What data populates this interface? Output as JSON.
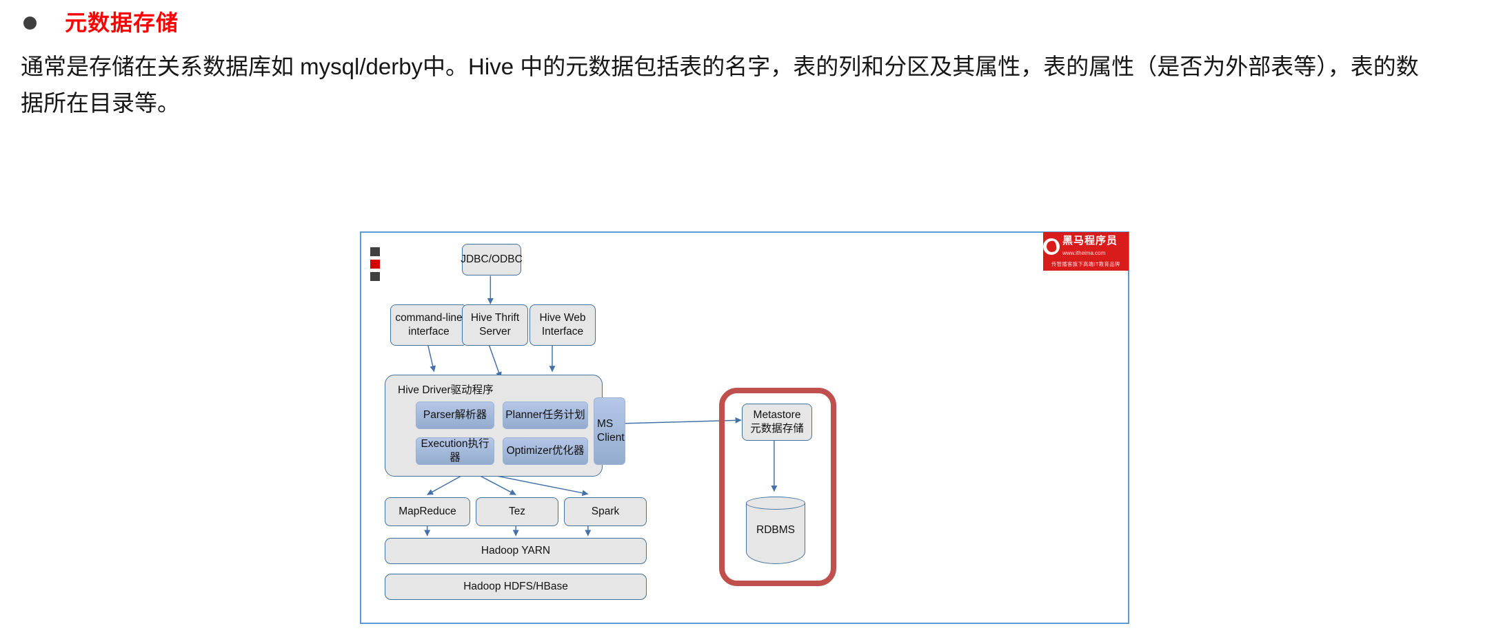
{
  "slide": {
    "heading": "元数据存储",
    "heading_color": "#ff0000",
    "paragraph": "通常是存储在关系数据库如 mysql/derby中。Hive 中的元数据包括表的名字，表的列和分区及其属性，表的属性（是否为外部表等），表的数据所在目录等。"
  },
  "diagram": {
    "border_color": "#5b9bd5",
    "node_fill": "#e6e6e6",
    "node_border": "#41719c",
    "subnode_fill": "#93accd",
    "highlight_color": "#c0504d",
    "nodes": {
      "jdbc_odbc": "JDBC/ODBC",
      "cli": "command-line\ninterface",
      "cli_line1": "command-line",
      "cli_line2": "interface",
      "thrift_line1": "Hive Thrift",
      "thrift_line2": "Server",
      "web_line1": "Hive Web",
      "web_line2": "Interface",
      "driver_label": "Hive Driver驱动程序",
      "parser": "Parser解析器",
      "planner": "Planner任务计划",
      "execution": "Execution执行器",
      "optimizer": "Optimizer优化器",
      "ms_client_line1": "MS",
      "ms_client_line2": "Client",
      "metastore_line1": "Metastore",
      "metastore_line2": "元数据存储",
      "rdbms": "RDBMS",
      "mapreduce": "MapReduce",
      "tez": "Tez",
      "spark": "Spark",
      "yarn": "Hadoop YARN",
      "hdfs": "Hadoop HDFS/HBase"
    },
    "logo": {
      "name_cn": "黑马程序员",
      "url": "www.itheima.com",
      "tagline": "传智播客旗下高端IT教育品牌",
      "bg": "#d81b1b"
    },
    "marks": {
      "square_1_color": "#404040",
      "square_2_color": "#d40000",
      "square_3_color": "#404040"
    }
  }
}
